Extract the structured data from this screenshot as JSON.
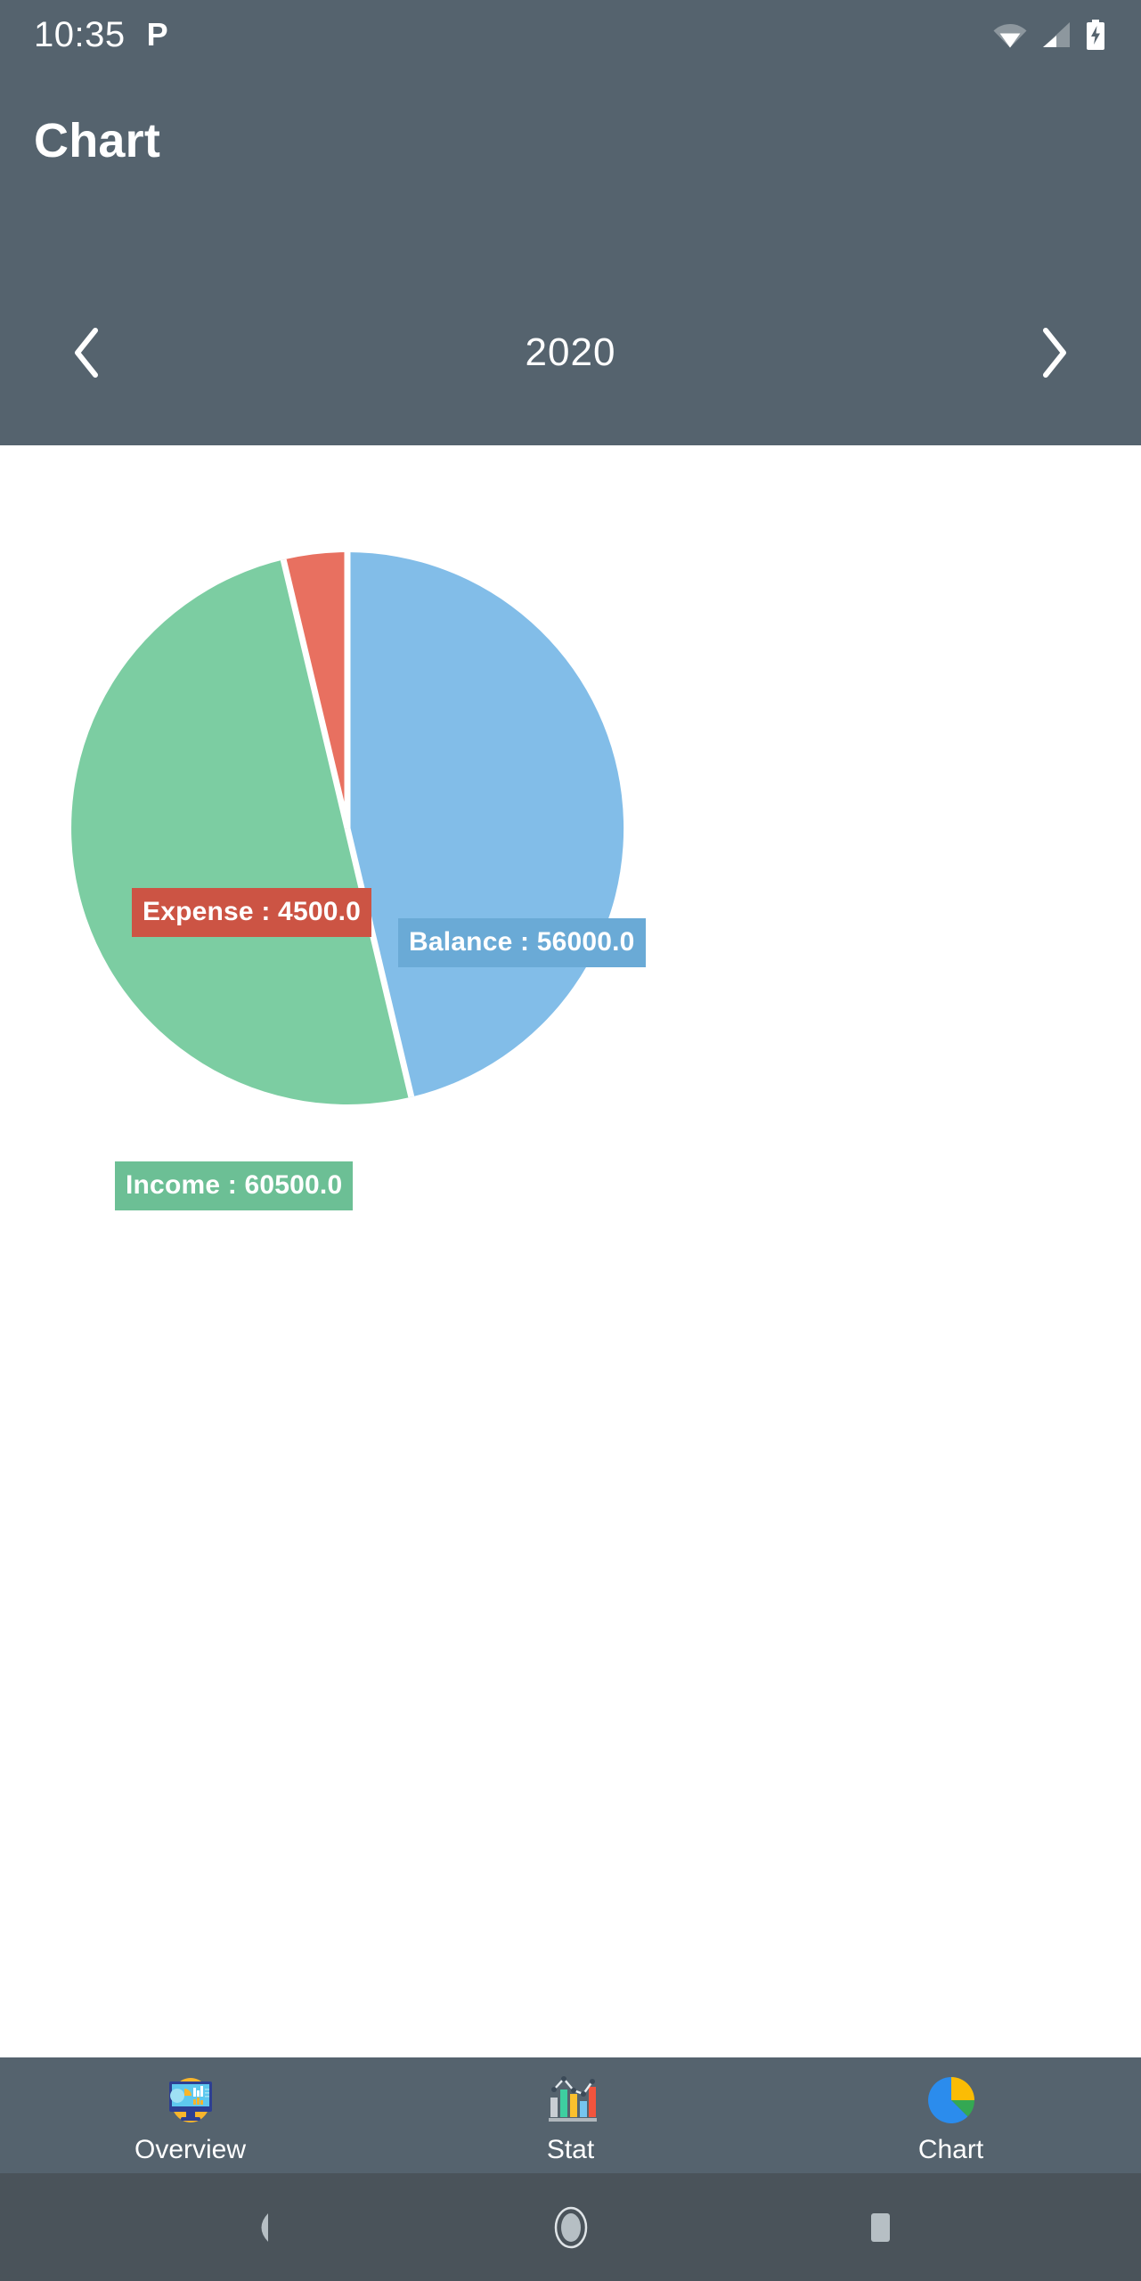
{
  "status_bar": {
    "clock": "10:35",
    "app_glyph": "P",
    "icons": [
      "wifi-icon",
      "cell-signal-icon",
      "battery-charging-icon"
    ]
  },
  "header": {
    "title": "Chart",
    "background_color": "#55636e",
    "prev_label": "‹",
    "next_label": "›",
    "year": "2020"
  },
  "chart_data": {
    "type": "pie",
    "title": "",
    "categories": [
      "Balance",
      "Income",
      "Expense"
    ],
    "values": [
      56000.0,
      60500.0,
      4500.0
    ],
    "total": 121000.0,
    "colors": [
      "#82bde8",
      "#7ccda2",
      "#e87060"
    ],
    "label_colors": [
      "#6aaad6",
      "#6cbf95",
      "#cc5444"
    ],
    "percents": [
      46.28,
      50.0,
      3.72
    ],
    "start_angle_deg": 0,
    "direction": "clockwise",
    "labels": [
      "Balance : 56000.0",
      "Income : 60500.0",
      "Expense : 4500.0"
    ],
    "legend": "inline-labels",
    "grid": false
  },
  "tabs": [
    {
      "label": "Overview",
      "icon": "dashboard-monitor-icon",
      "selected": false
    },
    {
      "label": "Stat",
      "icon": "bar-chart-icon",
      "selected": false
    },
    {
      "label": "Chart",
      "icon": "pie-chart-icon",
      "selected": true
    }
  ],
  "system_nav": {
    "back": "back-triangle-icon",
    "home": "home-circle-icon",
    "recents": "recents-square-icon"
  }
}
